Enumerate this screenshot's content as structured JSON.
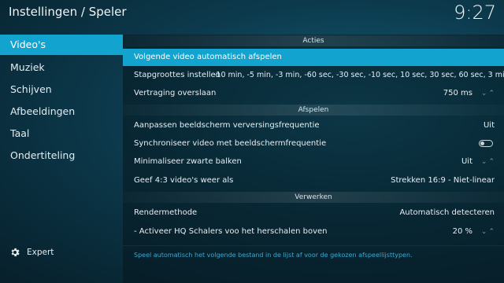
{
  "header": {
    "title": "Instellingen / Speler",
    "clock": "9:27"
  },
  "sidebar": {
    "items": [
      {
        "label": "Video's",
        "active": true
      },
      {
        "label": "Muziek"
      },
      {
        "label": "Schijven"
      },
      {
        "label": "Afbeeldingen"
      },
      {
        "label": "Taal"
      },
      {
        "label": "Ondertiteling"
      }
    ],
    "level_label": "Expert",
    "level_icon": "gear-icon"
  },
  "sections": {
    "acties": "Acties",
    "afspelen": "Afspelen",
    "verwerken": "Verwerken"
  },
  "settings": {
    "autoplay_next": {
      "label": "Volgende video automatisch afspelen"
    },
    "step_sizes": {
      "label": "Stapgroottes instellen",
      "value": "-10 min, -5 min, -3 min, -60 sec, -30 sec, -10 sec, 10 sec, 30 sec, 60 sec, 3 min, 5..."
    },
    "skip_delay": {
      "label": "Vertraging overslaan",
      "value": "750 ms"
    },
    "refresh_rate": {
      "label": "Aanpassen beeldscherm verversingsfrequentie",
      "value": "Uit"
    },
    "sync_video": {
      "label": "Synchroniseer video met beeldschermfrequentie",
      "state": "off"
    },
    "black_bars": {
      "label": "Minimaliseer zwarte balken",
      "value": "Uit"
    },
    "show_43": {
      "label": "Geef 4:3 video's weer als",
      "value": "Strekken 16:9 - Niet-linear"
    },
    "render_method": {
      "label": "Rendermethode",
      "value": "Automatisch detecteren"
    },
    "hq_scalers": {
      "label": "- Activeer HQ Schalers voo het herschalen boven",
      "value": "20 %"
    }
  },
  "help_text": "Speel automatisch het volgende bestand in de lijst af voor de gekozen afspeellijsttypen.",
  "colors": {
    "accent": "#12a4cf",
    "help": "#3aa9d3"
  }
}
